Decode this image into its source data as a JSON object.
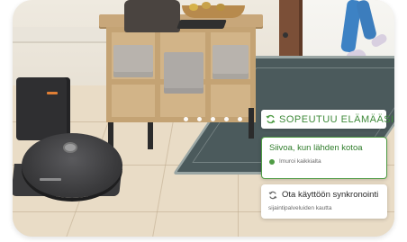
{
  "carousel": {
    "dot_count": 5,
    "active_index": 0
  },
  "header_pill": {
    "label": "SOPEUTUU ELÄMÄÄSI",
    "icon": "sync-icon"
  },
  "options": [
    {
      "title": "Siivoa, kun lähden kotoa",
      "subtitle": "Imuroi kaikkialta",
      "selected": true,
      "indicator": "green-dot-icon"
    },
    {
      "title": "Ota käyttöön synkronointi",
      "subtitle": "sijaintipalveluiden kautta",
      "selected": false,
      "icon": "sync-icon"
    }
  ],
  "colors": {
    "accent_green": "#4f9c45",
    "dark_text": "#2b2b2b"
  }
}
